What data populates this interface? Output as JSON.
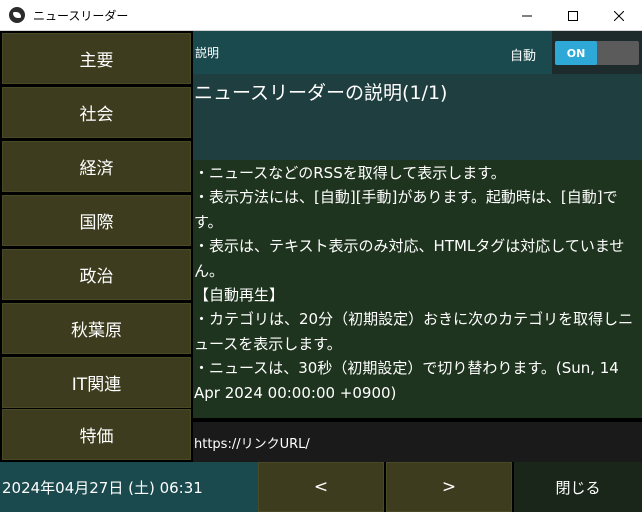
{
  "window": {
    "title": "ニュースリーダー",
    "app_icon": "app-icon"
  },
  "sidebar": {
    "items": [
      {
        "label": "主要"
      },
      {
        "label": "社会"
      },
      {
        "label": "経済"
      },
      {
        "label": "国際"
      },
      {
        "label": "政治"
      },
      {
        "label": "秋葉原"
      },
      {
        "label": "IT関連"
      },
      {
        "label": "特価"
      }
    ]
  },
  "header": {
    "label": "説明",
    "auto_label": "自動",
    "toggle_label": "ON",
    "toggle_state": "on"
  },
  "article": {
    "title": "ニュースリーダーの説明(1/1)",
    "body": "・ニュースなどのRSSを取得して表示します。\n・表示方法には、[自動][手動]があります。起動時は、[自動]です。\n・表示は、テキスト表示のみ対応、HTMLタグは対応していません。\n【自動再生】\n・カテゴリは、20分（初期設定）おきに次のカテゴリを取得しニュースを表示します。\n・ニュースは、30秒（初期設定）で切り替わります。(Sun, 14 Apr 2024 00:00:00 +0900)",
    "link": "https://リンクURL/"
  },
  "footer": {
    "datetime": "2024年04月27日 (土) 06:31",
    "prev_label": "<",
    "next_label": ">",
    "close_label": "閉じる"
  },
  "colors": {
    "accent": "#2ea8d6",
    "button_bg": "#3d3c1e",
    "header_bg": "#1a4a4d",
    "body_bg": "#1f341f"
  }
}
